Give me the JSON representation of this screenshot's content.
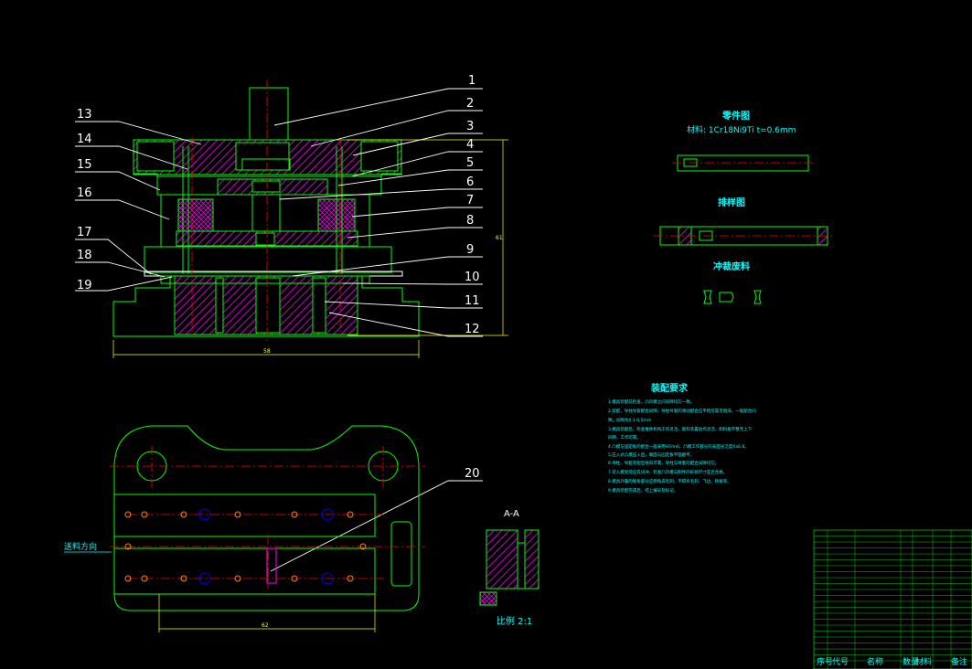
{
  "part_labels": [
    "1",
    "2",
    "3",
    "4",
    "5",
    "6",
    "7",
    "8",
    "9",
    "10",
    "11",
    "12",
    "13",
    "14",
    "15",
    "16",
    "17",
    "18",
    "19",
    "20"
  ],
  "section_label": "A-A",
  "scale_label": "比例 2:1",
  "feed_direction_label": "送料方向",
  "part_drawing": {
    "title": "零件图",
    "material": "材料: 1Cr18Ni9Ti  t=0.6mm"
  },
  "layout_title": "排样图",
  "blanking_title": "冲裁废料",
  "tech_requirements": {
    "title": "装配要求",
    "items": [
      "1.模具装配前检查，凸凹模之间间隙均匀一致。",
      "2.装配，导柱导套配合间隙，导柱导套的滑动配合应平稳可靠无阻滞，一般配合间",
      "  隙，间隙为0.1-0.5mm",
      "3.模具装配后，检查推件机构工作灵活，卸料装置动作灵活，卸料板平整无上下",
      "  间隙，工作可靠。",
      "4.凸模与固定板的配合一般采用H7/m6，凸模工作部分的表面光洁度Ra0.8。",
      "5.压入式凸模压入后，端面与固定板平面磨平。",
      "6.导柱、导套装配后导向可靠，导柱与导套的配合间隙均匀。",
      "7.装入模架前应先试冲，检查凸凹模与制件的形状尺寸是否合格。",
      "8.模具外露的棱角部分应倒角去毛刺，不得有毛刺、飞边、锐棱等。",
      "9.模具装配完成后，打上编号及标记。"
    ]
  },
  "dimensions": {
    "overall_width": "58",
    "overall_height": "61",
    "plan_width": "62"
  },
  "bom_header": [
    "序号",
    "代号",
    "名称",
    "数量",
    "材料",
    "备注"
  ],
  "colors": {
    "outline": "#00ff00",
    "section_hatch": "#ff00ff",
    "centerline": "#ff0000",
    "leader": "#ffffff",
    "annotation": "#00ffff",
    "dimension": "#ffff00",
    "bolt": "#0000ff"
  }
}
